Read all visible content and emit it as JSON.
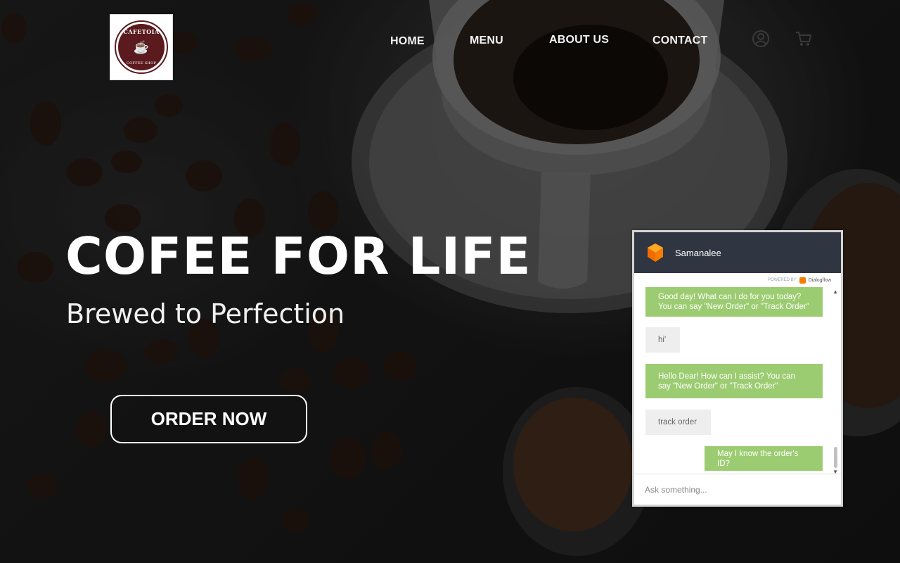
{
  "colors": {
    "chat_header_bg": "#2f3541",
    "bot_bubble": "#9ccc71",
    "user_bubble": "#eeeeee",
    "dialogflow_orange": "#f57c00"
  },
  "logo": {
    "top_text": "CAFETOIA",
    "bottom_text": "COFFEE SHOP",
    "icon": "coffee-cup-icon"
  },
  "nav": {
    "items": [
      {
        "label": "HOME"
      },
      {
        "label": "MENU"
      },
      {
        "label": "ABOUT US"
      },
      {
        "label": "CONTACT"
      }
    ],
    "icons": [
      "user-icon",
      "cart-icon"
    ]
  },
  "hero": {
    "title": "COFEE FOR LIFE",
    "subtitle": "Brewed to Perfection",
    "cta_label": "ORDER NOW"
  },
  "chat": {
    "bot_name": "Samanalee",
    "powered_by_label": "POWERED BY",
    "powered_by_brand": "Dialogflow",
    "messages": [
      {
        "from": "bot",
        "text": "Good day! What can I do for you today? You can say \"New Order\" or \"Track Order\""
      },
      {
        "from": "user",
        "text": "hi'"
      },
      {
        "from": "bot",
        "text": "Hello Dear! How can I assist? You can say \"New Order\" or \"Track Order\""
      },
      {
        "from": "user",
        "text": "track order"
      },
      {
        "from": "bot",
        "text": "May I know the order's ID?"
      }
    ],
    "input_placeholder": "Ask something..."
  }
}
